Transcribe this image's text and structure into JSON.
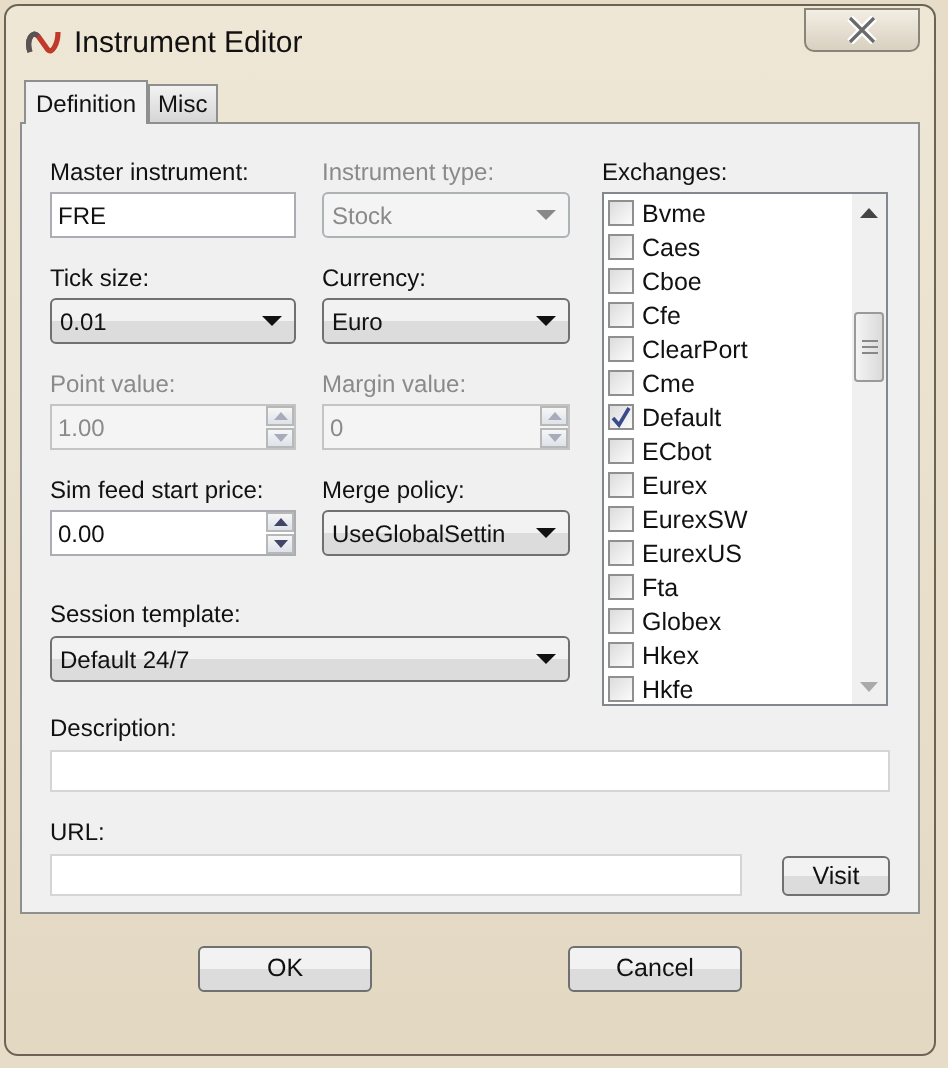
{
  "window": {
    "title": "Instrument Editor"
  },
  "tabs": [
    {
      "label": "Definition",
      "selected": true
    },
    {
      "label": "Misc",
      "selected": false
    }
  ],
  "fields": [
    {
      "label": "Master instrument:",
      "kind": "text",
      "value": "FRE",
      "disabled": false
    },
    {
      "label": "Instrument type:",
      "kind": "dropdown",
      "value": "Stock",
      "disabled": true
    },
    {
      "label": "Tick size:",
      "kind": "dropdown",
      "value": "0.01",
      "disabled": false
    },
    {
      "label": "Currency:",
      "kind": "dropdown",
      "value": "Euro",
      "disabled": false
    },
    {
      "label": "Point value:",
      "kind": "spin",
      "value": "1.00",
      "disabled": true
    },
    {
      "label": "Margin value:",
      "kind": "spin",
      "value": "0",
      "disabled": true
    },
    {
      "label": "Sim feed start price:",
      "kind": "spin",
      "value": "0.00",
      "disabled": false
    },
    {
      "label": "Merge policy:",
      "kind": "dropdown",
      "value": "UseGlobalSettin",
      "disabled": false
    },
    {
      "label": "Session template:",
      "kind": "dropdown",
      "value": "Default 24/7",
      "disabled": false,
      "wide": true
    }
  ],
  "exchanges": {
    "label": "Exchanges:",
    "items": [
      {
        "name": "Bvme",
        "checked": false
      },
      {
        "name": "Caes",
        "checked": false
      },
      {
        "name": "Cboe",
        "checked": false
      },
      {
        "name": "Cfe",
        "checked": false
      },
      {
        "name": "ClearPort",
        "checked": false
      },
      {
        "name": "Cme",
        "checked": false
      },
      {
        "name": "Default",
        "checked": true
      },
      {
        "name": "ECbot",
        "checked": false
      },
      {
        "name": "Eurex",
        "checked": false
      },
      {
        "name": "EurexSW",
        "checked": false
      },
      {
        "name": "EurexUS",
        "checked": false
      },
      {
        "name": "Fta",
        "checked": false
      },
      {
        "name": "Globex",
        "checked": false
      },
      {
        "name": "Hkex",
        "checked": false
      },
      {
        "name": "Hkfe",
        "checked": false
      }
    ]
  },
  "description": {
    "label": "Description:"
  },
  "url": {
    "label": "URL:",
    "button": "Visit"
  },
  "buttons": [
    "OK",
    "Cancel"
  ]
}
